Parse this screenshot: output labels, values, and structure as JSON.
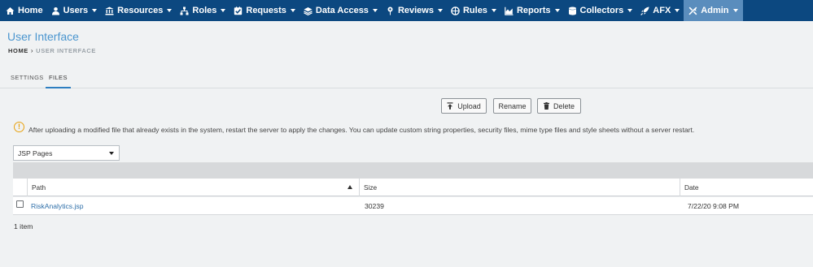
{
  "nav": {
    "items": [
      {
        "label": "Home",
        "icon": "home-icon",
        "caret": false
      },
      {
        "label": "Users",
        "icon": "user-icon",
        "caret": true
      },
      {
        "label": "Resources",
        "icon": "bank-icon",
        "caret": true
      },
      {
        "label": "Roles",
        "icon": "sitemap-icon",
        "caret": true
      },
      {
        "label": "Requests",
        "icon": "checkbox-icon",
        "caret": true
      },
      {
        "label": "Data Access",
        "icon": "layers-icon",
        "caret": true
      },
      {
        "label": "Reviews",
        "icon": "map-pin-icon",
        "caret": true
      },
      {
        "label": "Rules",
        "icon": "gavel-icon",
        "caret": true
      },
      {
        "label": "Reports",
        "icon": "area-chart-icon",
        "caret": true
      },
      {
        "label": "Collectors",
        "icon": "database-icon",
        "caret": true
      },
      {
        "label": "AFX",
        "icon": "rocket-icon",
        "caret": true
      },
      {
        "label": "Admin",
        "icon": "wrench-icon",
        "caret": true,
        "active": true
      }
    ]
  },
  "header": {
    "title": "User Interface",
    "breadcrumb": {
      "home": "HOME",
      "separator": "›",
      "current": "USER INTERFACE"
    }
  },
  "tabs": [
    {
      "label": "SETTINGS"
    },
    {
      "label": "FILES",
      "active": true
    }
  ],
  "toolbar": {
    "upload": "Upload",
    "rename": "Rename",
    "delete": "Delete"
  },
  "info": {
    "icon": "warning-icon",
    "symbol": "!",
    "message": "After uploading a modified file that already exists in the system, restart the server to apply the changes. You can update custom string properties, security files, mime type files and style sheets without a server restart."
  },
  "file_type_select": {
    "value": "JSP Pages"
  },
  "grid": {
    "columns": [
      {
        "label": "Path",
        "sorted": "ascending"
      },
      {
        "label": "Size"
      },
      {
        "label": "Date"
      }
    ],
    "rows": [
      {
        "path": "RiskAnalytics.jsp",
        "size": "30239",
        "date": "7/22/20 9:08 PM"
      }
    ],
    "count": "1 item"
  },
  "colors": {
    "nav_bg": "#0c4880",
    "nav_active": "#5a8dbd",
    "title": "#4b96cf",
    "link": "#2d6ea8",
    "warning": "#e8a10e"
  }
}
